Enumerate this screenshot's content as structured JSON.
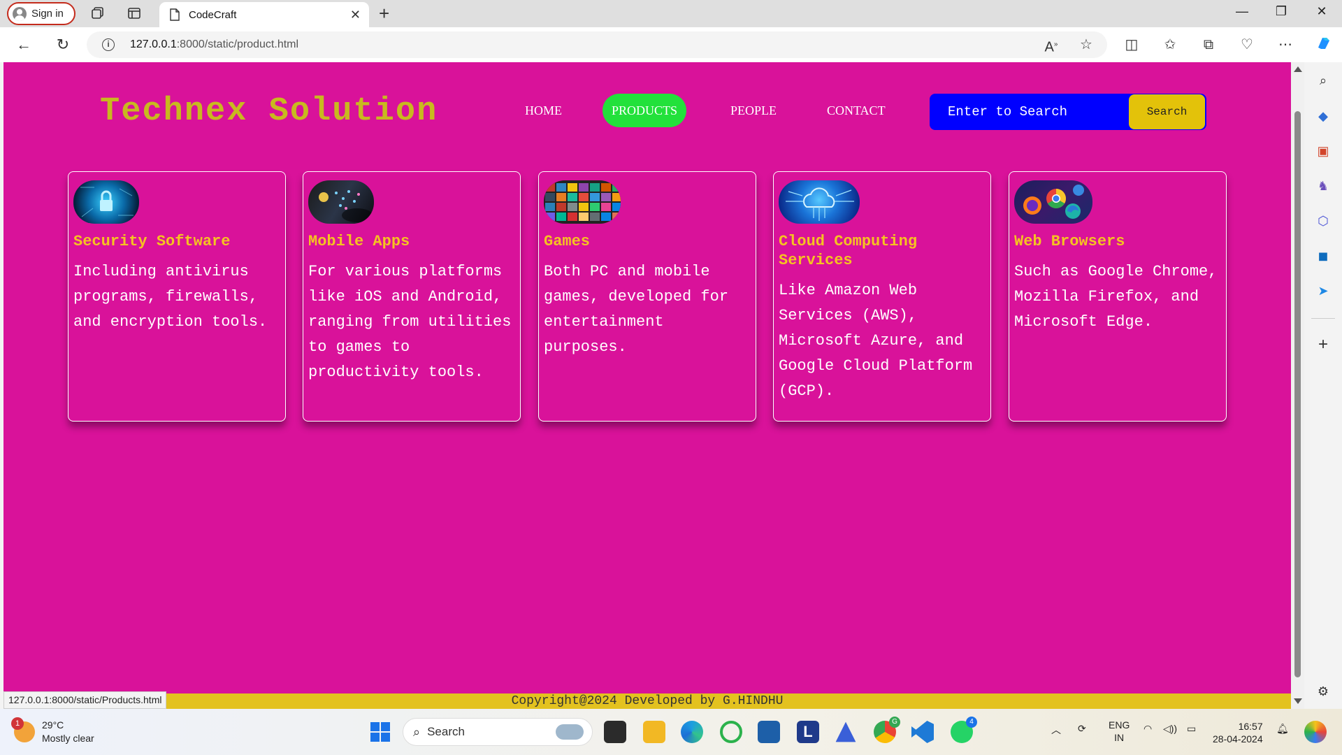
{
  "browser": {
    "signin_label": "Sign in",
    "tab_title": "CodeCraft",
    "url_host": "127.0.0.1",
    "url_path": ":8000/static/product.html",
    "status_url": "127.0.0.1:8000/static/Products.html"
  },
  "page": {
    "brand": "Technex Solution",
    "nav": [
      {
        "label": "HOME",
        "active": false
      },
      {
        "label": "PRODUCTS",
        "active": true
      },
      {
        "label": "PEOPLE",
        "active": false
      },
      {
        "label": "CONTACT",
        "active": false
      }
    ],
    "search": {
      "placeholder": "Enter to Search",
      "button_label": "Search"
    },
    "products": [
      {
        "title": "Security Software",
        "description": "Including antivirus programs, firewalls, and encryption tools.",
        "image": "security-lock-image"
      },
      {
        "title": "Mobile Apps",
        "description": "For various platforms like iOS and Android, ranging from utilities to games to productivity tools.",
        "image": "mobile-apps-image"
      },
      {
        "title": "Games",
        "description": "Both PC and mobile games, developed for entertainment purposes.",
        "image": "games-collage-image"
      },
      {
        "title": "Cloud Computing Services",
        "description": "Like Amazon Web Services (AWS), Microsoft Azure, and Google Cloud Platform (GCP).",
        "image": "cloud-circuit-image"
      },
      {
        "title": "Web Browsers",
        "description": "Such as Google Chrome, Mozilla Firefox, and Microsoft Edge.",
        "image": "browser-logos-image"
      }
    ],
    "footer": "Copyright@2024 Developed by G.HINDHU"
  },
  "taskbar": {
    "weather_temp": "29°C",
    "weather_desc": "Mostly clear",
    "weather_badge": "1",
    "search_label": "Search",
    "lang_top": "ENG",
    "lang_bottom": "IN",
    "time": "16:57",
    "date": "28-04-2024",
    "chrome_badge": "G",
    "whatsapp_badge": "4"
  },
  "colors": {
    "page_bg": "#d9129a",
    "brand": "#c8b91f",
    "active_nav": "#22e13b",
    "search_bg": "#0000ff",
    "search_button": "#e3c20a",
    "card_title": "#f5c321",
    "footer_bg": "#e3c21f"
  }
}
